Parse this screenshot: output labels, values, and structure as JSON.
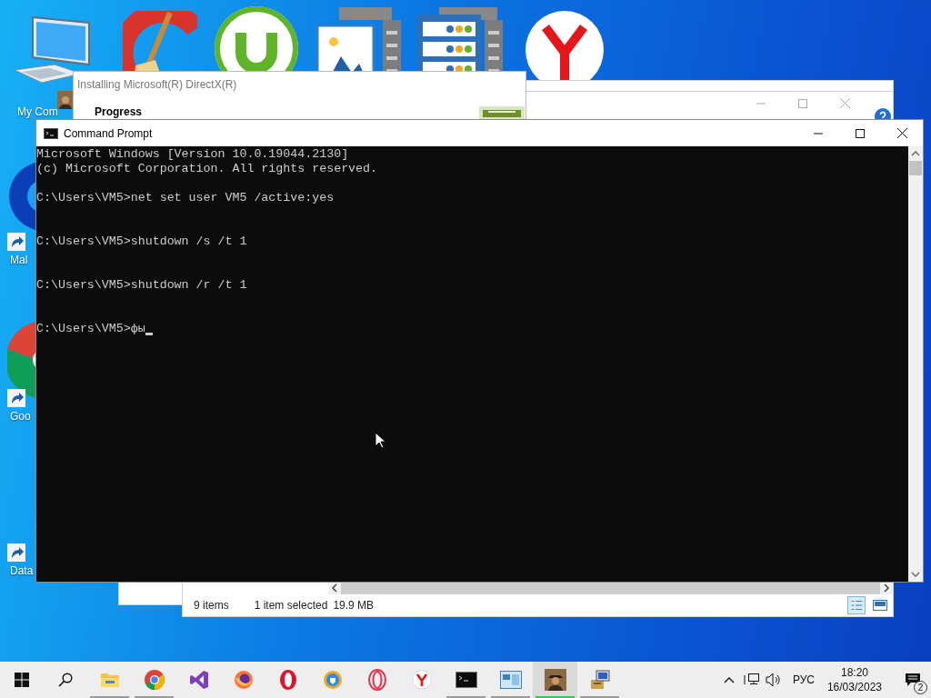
{
  "desktop_icons": [
    {
      "label": "My Com",
      "kind": "computer"
    },
    {
      "label": "Mal",
      "kind": "shortcut"
    },
    {
      "label": "Goo",
      "kind": "shortcut"
    },
    {
      "label": "Data",
      "kind": "shortcut"
    }
  ],
  "directx_window": {
    "title": "Installing Microsoft(R) DirectX(R)",
    "heading": "Progress"
  },
  "explorer_window": {
    "status_items": [
      "9 items",
      "1 item selected",
      "19.9 MB"
    ]
  },
  "command_prompt": {
    "title": "Command Prompt",
    "output": [
      {
        "kind": "banner",
        "lines": [
          "Microsoft Windows [Version 10.0.19044.2130]",
          "(c) Microsoft Corporation. All rights reserved."
        ]
      },
      {
        "kind": "command",
        "lines": [
          "C:\\Users\\VM5>net set user VM5 /active:yes"
        ]
      },
      {
        "kind": "command",
        "lines": [
          "C:\\Users\\VM5>shutdown /s /t 1"
        ]
      },
      {
        "kind": "command",
        "lines": [
          "C:\\Users\\VM5>shutdown /r /t 1"
        ]
      },
      {
        "kind": "input",
        "lines": [
          "C:\\Users\\VM5>фы"
        ]
      }
    ]
  },
  "taskbar": {
    "apps": [
      {
        "kind": "folder",
        "running": true,
        "selected": false
      },
      {
        "kind": "chrome",
        "running": true,
        "selected": false
      },
      {
        "kind": "vs",
        "running": false,
        "selected": false
      },
      {
        "kind": "firefox",
        "running": false,
        "selected": false
      },
      {
        "kind": "opera",
        "running": false,
        "selected": false
      },
      {
        "kind": "shield",
        "running": false,
        "selected": false
      },
      {
        "kind": "ring",
        "running": false,
        "selected": false
      },
      {
        "kind": "yandex",
        "running": false,
        "selected": false
      },
      {
        "kind": "console",
        "running": true,
        "selected": false
      },
      {
        "kind": "panel",
        "running": true,
        "selected": false
      },
      {
        "kind": "portrait",
        "running": true,
        "selected": true
      },
      {
        "kind": "installer",
        "running": true,
        "selected": false
      }
    ],
    "language": "РУС",
    "time": "18:20",
    "date": "16/03/2023",
    "notifications": "2"
  }
}
